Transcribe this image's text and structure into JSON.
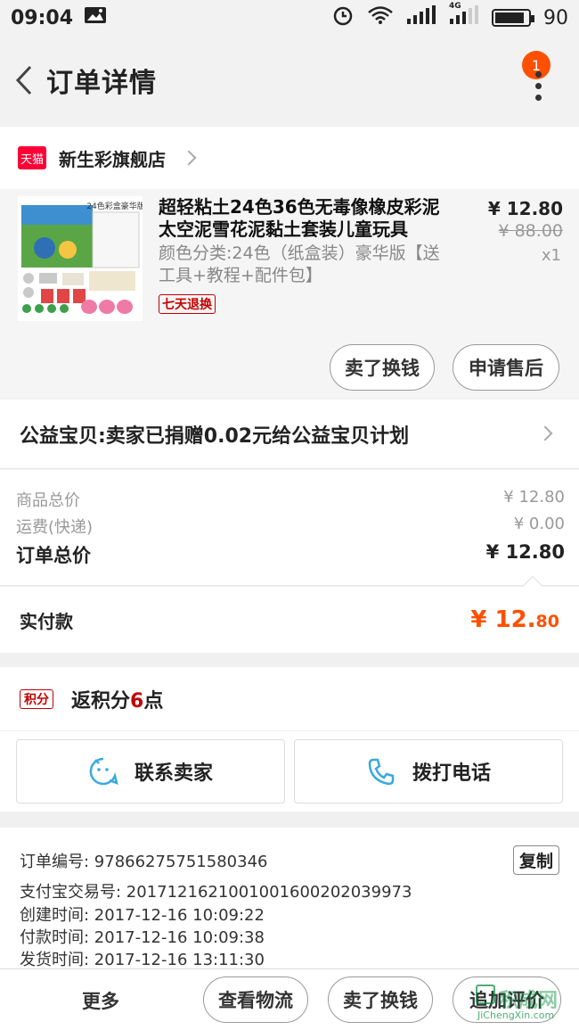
{
  "status_bar": {
    "time": "09:04",
    "signal_label": "4G",
    "battery": "90",
    "battery_level": 0.9
  },
  "nav": {
    "title": "订单详情",
    "badge": "1"
  },
  "shop": {
    "badge": "天猫",
    "name": "新生彩旗舰店"
  },
  "product": {
    "title": "超轻粘土24色36色无毒像橡皮彩泥太空泥雪花泥黏土套装儿童玩具",
    "spec": "颜色分类:24色（纸盒装）豪华版【送工具+教程+配件包】",
    "return_tag": "七天退换",
    "price": "¥ 12.80",
    "original_price": "¥ 88.00",
    "quantity": "x1",
    "image_label": "24色彩盒豪华版",
    "buttons": {
      "sell": "卖了换钱",
      "after_sale": "申请售后"
    }
  },
  "charity": {
    "text": "公益宝贝:卖家已捐赠0.02元给公益宝贝计划"
  },
  "summary": {
    "goods_label": "商品总价",
    "goods_value": "¥ 12.80",
    "shipping_label": "运费(快递)",
    "shipping_value": "¥ 0.00",
    "total_label": "订单总价",
    "total_value": "¥ 12.80"
  },
  "paid": {
    "label": "实付款",
    "amount_main": "¥ 12.",
    "amount_cents": "80"
  },
  "points": {
    "tag": "积分",
    "text_prefix": "返积分",
    "count": "6",
    "text_suffix": "点"
  },
  "contacts": {
    "seller": "联系卖家",
    "phone": "拨打电话"
  },
  "order_info": {
    "order_no": "订单编号: 97866275751580346",
    "alipay_no": "支付宝交易号: 2017121621001001600202039973",
    "created": "创建时间: 2017-12-16 10:09:22",
    "paid": "付款时间: 2017-12-16 10:09:38",
    "shipped": "发货时间: 2017-12-16 13:11:30",
    "copy_label": "复制"
  },
  "bottom_bar": {
    "more": "更多",
    "logistics": "查看物流",
    "sell": "卖了换钱",
    "review": "追加评价"
  },
  "watermark": {
    "brand": "积成网",
    "url": "JiChengXin.com"
  },
  "colors": {
    "accent": "#ff5000",
    "tmall_red": "#ff0036",
    "tag_red": "#c40000"
  }
}
